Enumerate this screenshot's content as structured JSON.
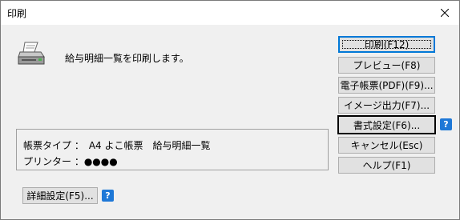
{
  "window": {
    "title": "印刷",
    "close_icon": "close-icon"
  },
  "message": "給与明細一覧を印刷します。",
  "info": {
    "form_type": "帳票タイプ ：　A4 よこ帳票　給与明細一覧",
    "printer": "プリンター ：●●●●"
  },
  "buttons": {
    "print": "印刷(F12)",
    "preview": "プレビュー(F8)",
    "pdf": "電子帳票(PDF)(F9)...",
    "image_output": "イメージ出力(F7)...",
    "format_settings": "書式設定(F6)...",
    "cancel": "キャンセル(Esc)",
    "help": "ヘルプ(F1)",
    "detail_settings": "詳細設定(F5)..."
  },
  "help_glyph": "?",
  "colors": {
    "accent": "#0078d7",
    "help_badge": "#1e78d7",
    "face": "#f0f0f0"
  }
}
